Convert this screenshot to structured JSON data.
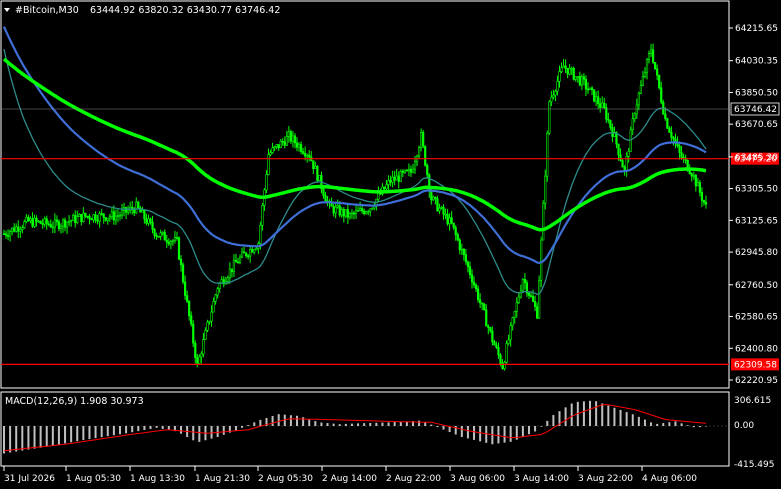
{
  "header": {
    "symbol": "#Bitcoin,M30",
    "ohlc": "63444.92 63820.32 63430.77 63746.42",
    "menu_icon": "triangle-down-icon"
  },
  "price_axis": {
    "ticks": [
      "64215.65",
      "64030.35",
      "63850.50",
      "63670.65",
      "63485.30",
      "63305.50",
      "63125.65",
      "62945.80",
      "62760.50",
      "62580.65",
      "62400.80",
      "62220.95"
    ],
    "current_price": "63746.42",
    "lines": [
      {
        "label": "63475.20",
        "value": 63475.2,
        "color": "#ff0000"
      },
      {
        "label": "62309.58",
        "value": 62309.58,
        "color": "#ff0000"
      }
    ]
  },
  "macd": {
    "label": "MACD(12,26,9) 1.908 30.973",
    "ticks": [
      "306.615",
      "0.00",
      "-415.495"
    ]
  },
  "time_axis": {
    "labels": [
      "31 Jul 2026",
      "1 Aug 05:30",
      "1 Aug 13:30",
      "1 Aug 21:30",
      "2 Aug 05:30",
      "2 Aug 14:00",
      "2 Aug 22:00",
      "3 Aug 06:00",
      "3 Aug 14:00",
      "3 Aug 22:00",
      "4 Aug 06:00"
    ]
  },
  "colors": {
    "background": "#000000",
    "bull": "#00ff00",
    "bear": "#00ff00",
    "ma_fast": "#2e8b8b",
    "ma_mid": "#3f6fd6",
    "ma_slow": "#00ff00",
    "signal": "#ff0000",
    "hist": "#c0c0c0",
    "axis": "#ffffff",
    "grid": "#555555"
  },
  "chart_data": {
    "type": "candlestick",
    "price_range": [
      62220.95,
      64300
    ],
    "key_prices": [
      [
        0,
        63050
      ],
      [
        12,
        63120
      ],
      [
        25,
        63100
      ],
      [
        40,
        63150
      ],
      [
        55,
        63150
      ],
      [
        65,
        63200
      ],
      [
        75,
        63050
      ],
      [
        85,
        63000
      ],
      [
        95,
        62300
      ],
      [
        105,
        62750
      ],
      [
        115,
        62900
      ],
      [
        125,
        63000
      ],
      [
        130,
        63500
      ],
      [
        140,
        63600
      ],
      [
        150,
        63500
      ],
      [
        160,
        63200
      ],
      [
        170,
        63150
      ],
      [
        180,
        63200
      ],
      [
        190,
        63350
      ],
      [
        200,
        63400
      ],
      [
        205,
        63600
      ],
      [
        210,
        63250
      ],
      [
        220,
        63100
      ],
      [
        230,
        62800
      ],
      [
        240,
        62450
      ],
      [
        245,
        62300
      ],
      [
        255,
        62800
      ],
      [
        262,
        62600
      ],
      [
        268,
        63800
      ],
      [
        275,
        64000
      ],
      [
        285,
        63900
      ],
      [
        295,
        63750
      ],
      [
        300,
        63600
      ],
      [
        305,
        63400
      ],
      [
        310,
        63750
      ],
      [
        318,
        64100
      ],
      [
        325,
        63700
      ],
      [
        332,
        63500
      ],
      [
        338,
        63400
      ],
      [
        345,
        63200
      ]
    ],
    "macd_hist": [
      [
        0,
        -300
      ],
      [
        20,
        -230
      ],
      [
        40,
        -150
      ],
      [
        60,
        -80
      ],
      [
        75,
        -20
      ],
      [
        85,
        -60
      ],
      [
        95,
        -180
      ],
      [
        105,
        -120
      ],
      [
        115,
        -40
      ],
      [
        125,
        60
      ],
      [
        135,
        130
      ],
      [
        145,
        110
      ],
      [
        155,
        40
      ],
      [
        165,
        20
      ],
      [
        175,
        30
      ],
      [
        190,
        40
      ],
      [
        205,
        60
      ],
      [
        215,
        -30
      ],
      [
        225,
        -120
      ],
      [
        240,
        -200
      ],
      [
        250,
        -170
      ],
      [
        262,
        -50
      ],
      [
        270,
        120
      ],
      [
        280,
        260
      ],
      [
        290,
        280
      ],
      [
        300,
        200
      ],
      [
        310,
        120
      ],
      [
        320,
        20
      ],
      [
        330,
        50
      ],
      [
        340,
        -20
      ],
      [
        345,
        0
      ]
    ],
    "macd_signal": [
      [
        0,
        -270
      ],
      [
        30,
        -200
      ],
      [
        60,
        -100
      ],
      [
        80,
        -40
      ],
      [
        100,
        -80
      ],
      [
        120,
        -40
      ],
      [
        140,
        80
      ],
      [
        160,
        70
      ],
      [
        190,
        50
      ],
      [
        210,
        40
      ],
      [
        230,
        -60
      ],
      [
        250,
        -130
      ],
      [
        265,
        -90
      ],
      [
        280,
        120
      ],
      [
        295,
        240
      ],
      [
        310,
        180
      ],
      [
        325,
        70
      ],
      [
        345,
        30
      ]
    ]
  }
}
